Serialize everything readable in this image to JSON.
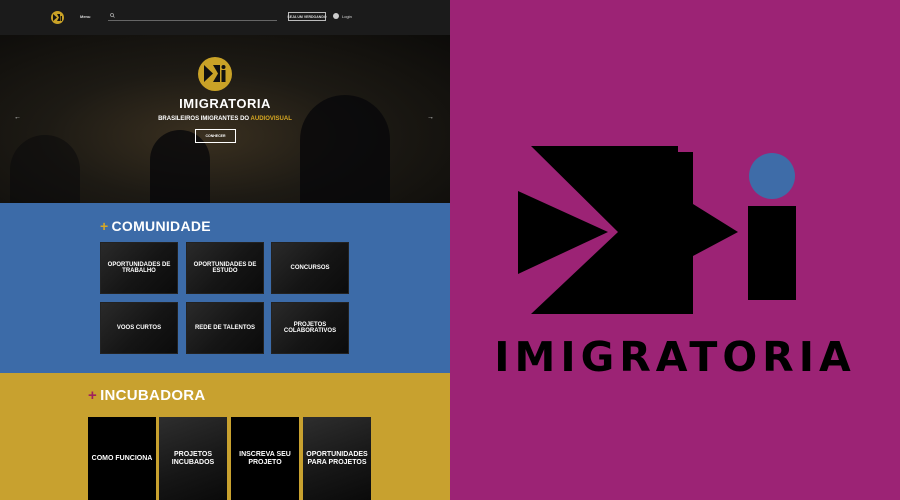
{
  "site": {
    "topbar": {
      "menu_label": "Menu",
      "search_placeholder": "",
      "signup_label": "SEJA UM VERDOANDO",
      "login_label": "Login"
    },
    "hero": {
      "title": "IMIGRATORIA",
      "subtitle_prefix": "BRASILEIROS IMIGRANTES DO ",
      "subtitle_highlight": "AUDIOVISUAL",
      "cta_label": "CONHECER",
      "prev_icon": "chevron-left-icon",
      "next_icon": "chevron-right-icon"
    },
    "comunidade": {
      "title": "COMUNIDADE",
      "tiles": [
        "OPORTUNIDADES DE TRABALHO",
        "OPORTUNIDADES DE ESTUDO",
        "CONCURSOS",
        "VOOS CURTOS",
        "REDE DE TALENTOS",
        "PROJETOS COLABORATIVOS"
      ]
    },
    "incubadora": {
      "title": "INCUBADORA",
      "tiles": [
        "COMO FUNCIONA",
        "PROJETOS INCUBADOS",
        "INSCREVA SEU PROJETO",
        "OPORTUNIDADES PARA PROJETOS"
      ]
    }
  },
  "brand": {
    "name": "IMIGRATORIA",
    "background_color": "#9c2375",
    "dot_color": "#3e6ca8"
  },
  "colors": {
    "accent_gold": "#d8a923",
    "community_blue": "#3c6ba8",
    "incubator_gold": "#c8a12f"
  }
}
